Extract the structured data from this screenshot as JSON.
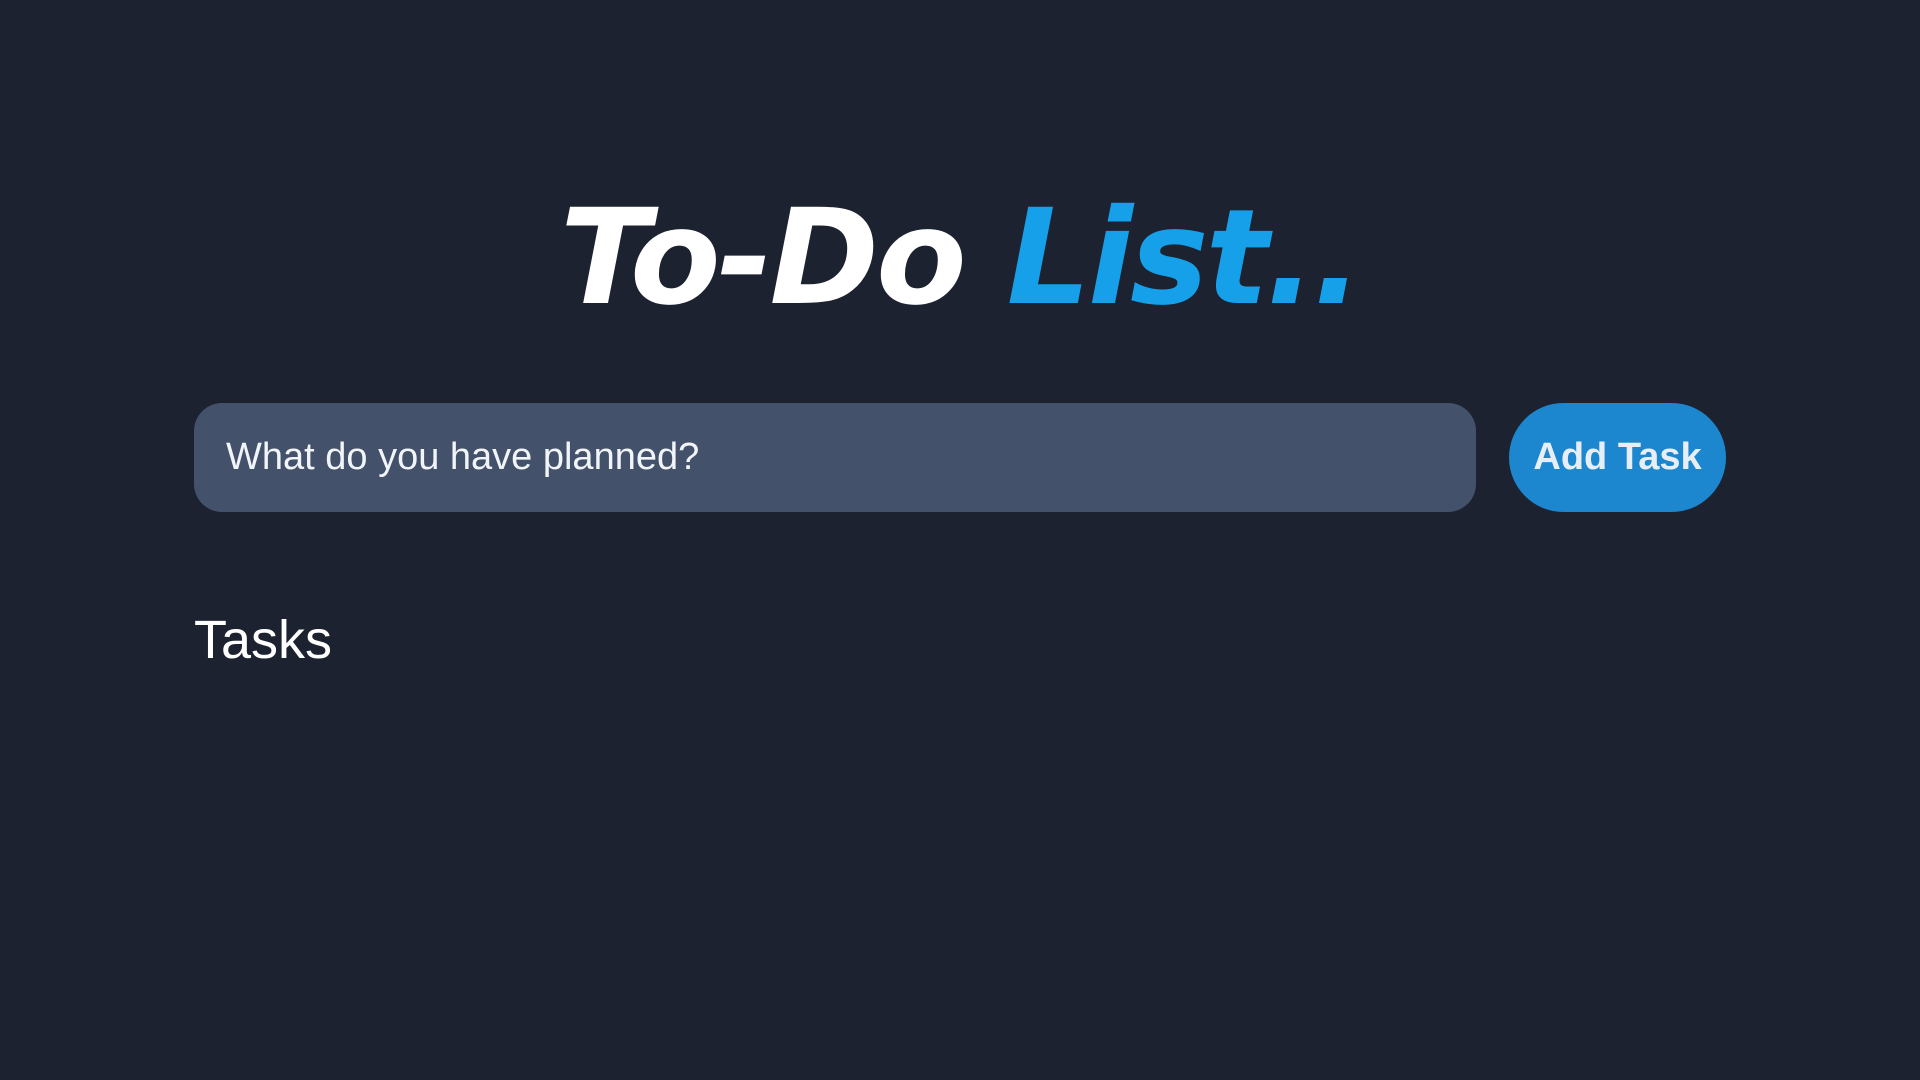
{
  "header": {
    "title_part1": "To-Do",
    "title_part2": "List..",
    "accent_color": "#16a0ea"
  },
  "task_form": {
    "input_placeholder": "What do you have planned?",
    "input_value": "",
    "add_button_label": "Add Task",
    "button_color": "#1c87cf"
  },
  "tasks_section": {
    "heading": "Tasks",
    "items": []
  },
  "theme": {
    "background": "#1c2230",
    "input_background": "#43516a"
  }
}
